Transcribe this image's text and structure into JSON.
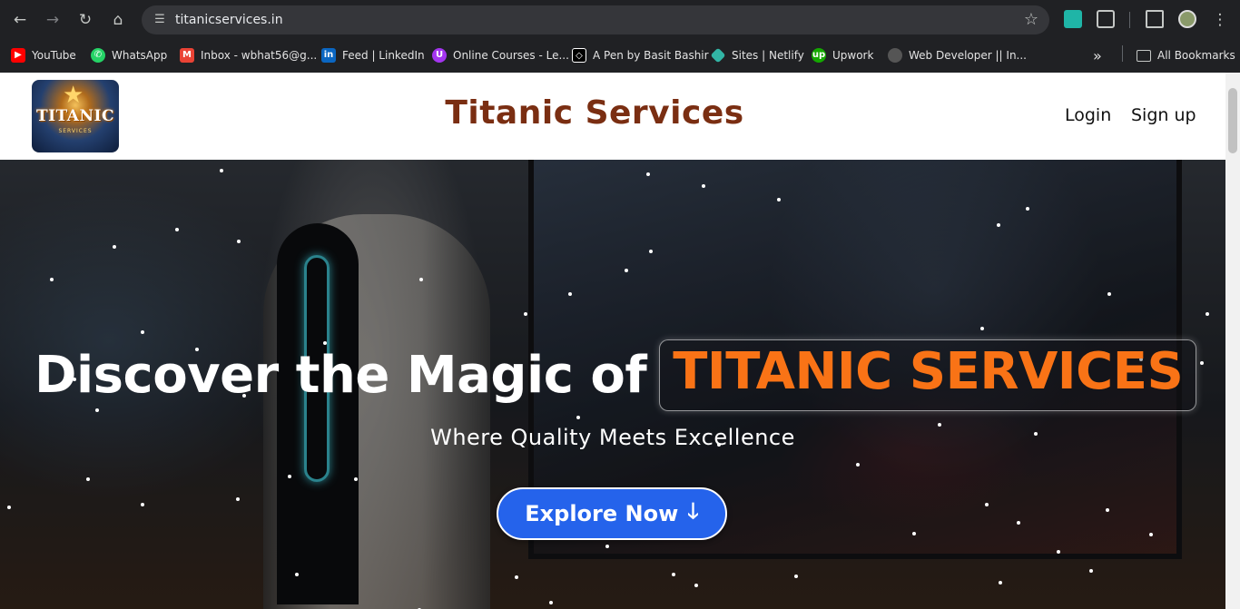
{
  "browser": {
    "url": "titanicservices.in",
    "bookmarks": [
      {
        "label": "YouTube",
        "icon": "youtube-icon",
        "color": "#ff0000"
      },
      {
        "label": "WhatsApp",
        "icon": "whatsapp-icon",
        "color": "#25d366"
      },
      {
        "label": "Inbox - wbhat56@g...",
        "icon": "gmail-icon",
        "color": "#ea4335"
      },
      {
        "label": "Feed | LinkedIn",
        "icon": "linkedin-icon",
        "color": "#0a66c2"
      },
      {
        "label": "Online Courses - Le...",
        "icon": "udemy-icon",
        "color": "#a435f0"
      },
      {
        "label": "A Pen by Basit Bashir",
        "icon": "codepen-icon",
        "color": "#000000"
      },
      {
        "label": "Sites | Netlify",
        "icon": "netlify-icon",
        "color": "#32b5a5"
      },
      {
        "label": "Upwork",
        "icon": "upwork-icon",
        "color": "#14a800"
      },
      {
        "label": "Web Developer || In...",
        "icon": "profile-icon",
        "color": "#555555"
      }
    ],
    "all_bookmarks": "All Bookmarks"
  },
  "header": {
    "logo_text": "TITANIC",
    "logo_sub": "SERVICES",
    "title": "Titanic Services",
    "login": "Login",
    "signup": "Sign up"
  },
  "hero": {
    "heading_lead": "Discover the Magic of",
    "heading_highlight": "TITANIC SERVICES",
    "subheading": "Where Quality Meets Excellence",
    "button_label": "Explore Now",
    "button_arrow": "🡓"
  },
  "colors": {
    "title": "#7a2e12",
    "highlight": "#f97316",
    "button": "#2563eb"
  }
}
